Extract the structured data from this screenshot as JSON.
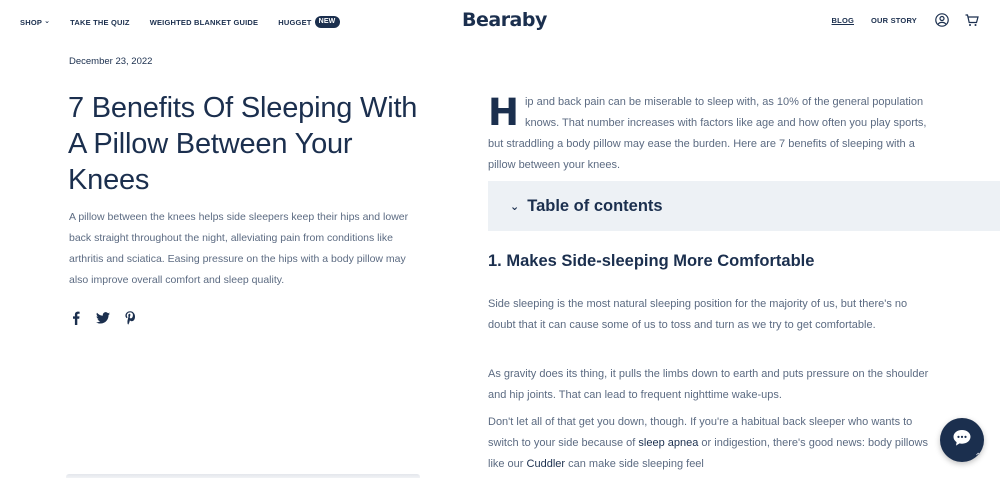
{
  "header": {
    "nav_left": [
      {
        "label": "SHOP",
        "has_chevron": true
      },
      {
        "label": "TAKE THE QUIZ"
      },
      {
        "label": "WEIGHTED BLANKET GUIDE"
      },
      {
        "label": "HUGGET",
        "badge": "NEW"
      }
    ],
    "logo": "Bearaby",
    "nav_right": [
      {
        "label": "BLOG",
        "active": true
      },
      {
        "label": "OUR STORY"
      }
    ],
    "icons": [
      "account-icon",
      "cart-icon"
    ]
  },
  "article": {
    "date": "December 23, 2022",
    "title": "7 Benefits Of Sleeping With A Pillow Between Your Knees",
    "intro": "A pillow between the knees helps side sleepers keep their hips and lower back straight throughout the night, alleviating pain from conditions like arthritis and sciatica. Easing pressure on the hips with a body pillow may also improve overall comfort and sleep quality.",
    "share_icons": [
      "facebook-icon",
      "twitter-icon",
      "pinterest-icon"
    ],
    "dropcap": "H",
    "lead": "ip and back pain can be miserable to sleep with, as 10% of the general population knows. That number increases with factors like age and how often you play sports, but straddling a body pillow may ease the burden. Here are 7 benefits of sleeping with a pillow between your knees.",
    "toc_label": "Table of contents",
    "section_heading": "1. Makes Side-sleeping More Comfortable",
    "p1": "Side sleeping is the most natural sleeping position for the majority of us, but there's no doubt that it can cause some of us to toss and turn as we try to get comfortable.",
    "p2": "As gravity does its thing, it pulls the limbs down to earth and puts pressure on the shoulder and hip joints. That can lead to frequent nighttime wake-ups.",
    "p3_a": "Don't let all of that get you down, though. If you're a habitual back sleeper who wants to switch to your side because of ",
    "p3_link1": "sleep apnea",
    "p3_b": " or indigestion, there's good news: body pillows like our ",
    "p3_link2": "Cuddler",
    "p3_c": " can make side sleeping feel"
  },
  "colors": {
    "navy": "#1b2f4e",
    "body_text": "#5c6b82",
    "toc_bg": "#edf1f5"
  }
}
